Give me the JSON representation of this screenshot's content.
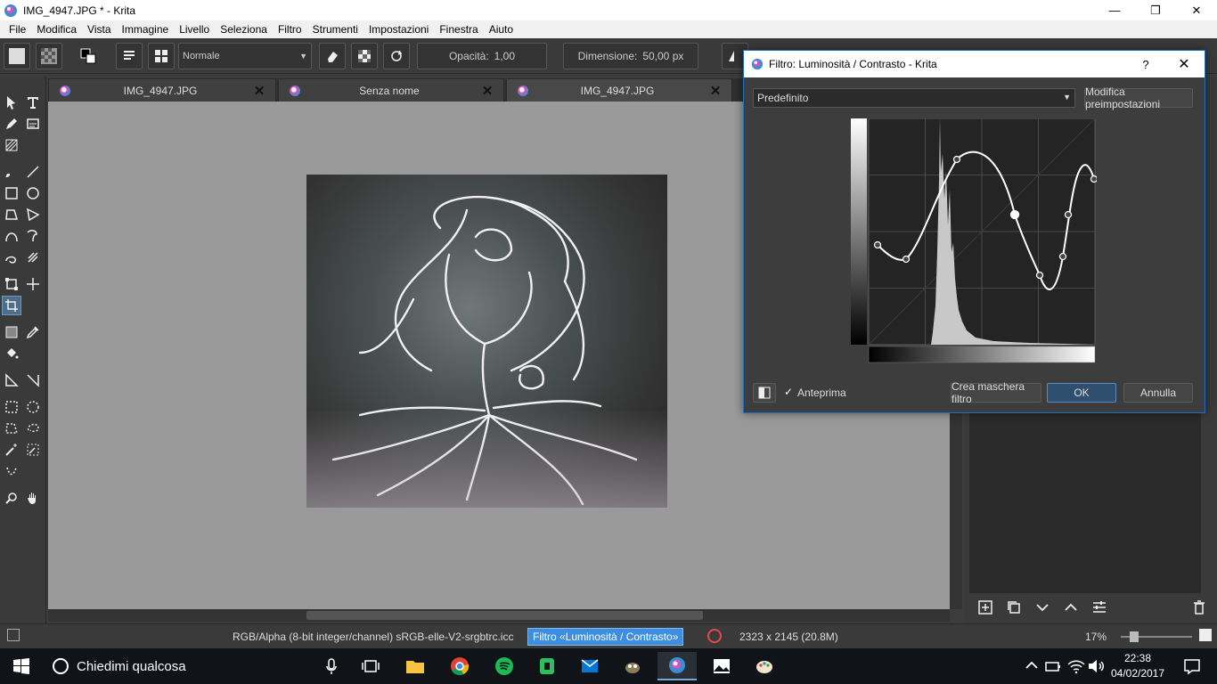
{
  "window": {
    "title": "IMG_4947.JPG * - Krita",
    "minimize_glyph": "—",
    "maximize_glyph": "❐",
    "close_glyph": "✕"
  },
  "menu": [
    "File",
    "Modifica",
    "Vista",
    "Immagine",
    "Livello",
    "Seleziona",
    "Filtro",
    "Strumenti",
    "Impostazioni",
    "Finestra",
    "Aiuto"
  ],
  "toolbar": {
    "blend_mode": "Normale",
    "opacity_label": "Opacità:",
    "opacity_value": "1,00",
    "size_label": "Dimensione:",
    "size_value": "50,00 px"
  },
  "tabs": [
    {
      "label": "IMG_4947.JPG",
      "close": "✕"
    },
    {
      "label": "Senza nome",
      "close": "✕"
    },
    {
      "label": "IMG_4947.JPG",
      "close": "✕"
    }
  ],
  "dialog": {
    "title": "Filtro: Luminosità / Contrasto - Krita",
    "help_glyph": "?",
    "close_glyph": "✕",
    "preset": "Predefinito",
    "edit_presets_button": "Modifica preimpostazioni",
    "preview_label": "Anteprima",
    "preview_checked": true,
    "check_glyph": "✓",
    "create_mask_button": "Crea maschera filtro",
    "ok_button": "OK",
    "cancel_button": "Annulla"
  },
  "status": {
    "color_space": "RGB/Alpha (8-bit integer/channel)  sRGB-elle-V2-srgbtrc.icc",
    "filter_name": "Filtro «Luminosità / Contrasto»",
    "image_size": "2323 x 2145 (20.8M)",
    "zoom": "17%"
  },
  "taskbar": {
    "search_placeholder": "Chiedimi qualcosa",
    "time": "22:38",
    "date": "04/02/2017"
  },
  "colors": {
    "accent": "#3d8ee0",
    "dialog_border": "#1e6fbf",
    "canvas_bg": "#9a9a9a",
    "panel_bg": "#3a3a3a"
  }
}
